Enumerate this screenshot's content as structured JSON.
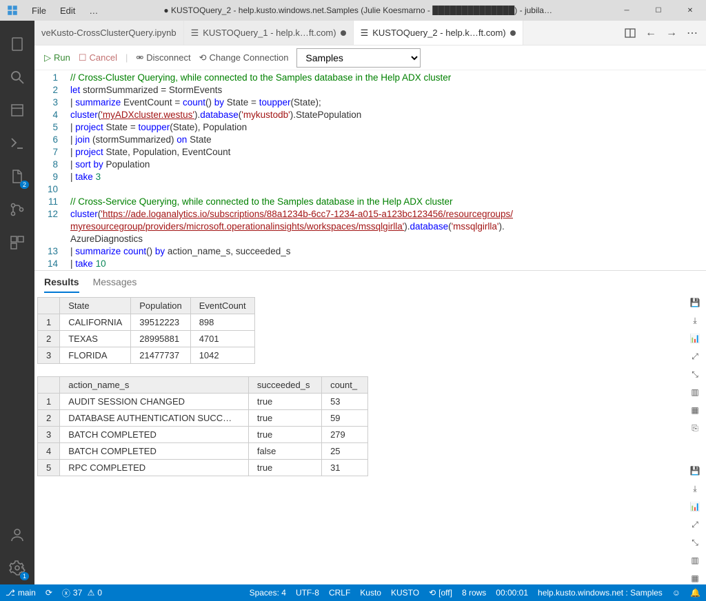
{
  "titlebar": {
    "menu": [
      "File",
      "Edit",
      "…"
    ],
    "title": "● KUSTOQuery_2 - help.kusto.windows.net.Samples (Julie Koesmarno - ██████████████) - jubila…"
  },
  "activity": {
    "explorer_badge": "2",
    "settings_badge": "1"
  },
  "tabs": [
    {
      "label": "veKusto-CrossClusterQuery.ipynb",
      "dirty": false
    },
    {
      "label": "KUSTOQuery_1 - help.k…ft.com)",
      "dirty": true
    },
    {
      "label": "KUSTOQuery_2 - help.k…ft.com)",
      "dirty": true,
      "active": true
    }
  ],
  "toolbar": {
    "run": "Run",
    "cancel": "Cancel",
    "disconnect": "Disconnect",
    "change_conn": "Change Connection",
    "db_selected": "Samples"
  },
  "code": {
    "lines": [
      {
        "n": "1",
        "seg": [
          {
            "c": "tok-comment",
            "t": "// Cross-Cluster Querying, while connected to the Samples database in the Help ADX cluster"
          }
        ]
      },
      {
        "n": "2",
        "seg": [
          {
            "c": "tok-kw",
            "t": "let"
          },
          {
            "c": "",
            "t": " stormSummarized = StormEvents"
          }
        ]
      },
      {
        "n": "3",
        "seg": [
          {
            "c": "",
            "t": "| "
          },
          {
            "c": "tok-kw",
            "t": "summarize"
          },
          {
            "c": "",
            "t": " EventCount = "
          },
          {
            "c": "tok-func",
            "t": "count"
          },
          {
            "c": "",
            "t": "() "
          },
          {
            "c": "tok-kw",
            "t": "by"
          },
          {
            "c": "",
            "t": " State = "
          },
          {
            "c": "tok-func",
            "t": "toupper"
          },
          {
            "c": "",
            "t": "(State);"
          }
        ]
      },
      {
        "n": "4",
        "seg": [
          {
            "c": "tok-func",
            "t": "cluster"
          },
          {
            "c": "",
            "t": "("
          },
          {
            "c": "tok-str",
            "t": "'myADXcluster.westus'"
          },
          {
            "c": "",
            "t": ")."
          },
          {
            "c": "tok-func",
            "t": "database"
          },
          {
            "c": "",
            "t": "("
          },
          {
            "c": "tok-str2",
            "t": "'mykustodb'"
          },
          {
            "c": "",
            "t": ").StatePopulation"
          }
        ]
      },
      {
        "n": "5",
        "seg": [
          {
            "c": "",
            "t": "| "
          },
          {
            "c": "tok-kw",
            "t": "project"
          },
          {
            "c": "",
            "t": " State = "
          },
          {
            "c": "tok-func",
            "t": "toupper"
          },
          {
            "c": "",
            "t": "(State), Population"
          }
        ]
      },
      {
        "n": "6",
        "seg": [
          {
            "c": "",
            "t": "| "
          },
          {
            "c": "tok-kw",
            "t": "join"
          },
          {
            "c": "",
            "t": " (stormSummarized) "
          },
          {
            "c": "tok-kw",
            "t": "on"
          },
          {
            "c": "",
            "t": " State"
          }
        ]
      },
      {
        "n": "7",
        "seg": [
          {
            "c": "",
            "t": "| "
          },
          {
            "c": "tok-kw",
            "t": "project"
          },
          {
            "c": "",
            "t": " State, Population, EventCount"
          }
        ]
      },
      {
        "n": "8",
        "seg": [
          {
            "c": "",
            "t": "| "
          },
          {
            "c": "tok-kw",
            "t": "sort by"
          },
          {
            "c": "",
            "t": " Population"
          }
        ]
      },
      {
        "n": "9",
        "seg": [
          {
            "c": "",
            "t": "| "
          },
          {
            "c": "tok-kw",
            "t": "take"
          },
          {
            "c": "",
            "t": " "
          },
          {
            "c": "tok-num",
            "t": "3"
          }
        ]
      },
      {
        "n": "10",
        "seg": [
          {
            "c": "",
            "t": ""
          }
        ]
      },
      {
        "n": "11",
        "seg": [
          {
            "c": "tok-comment",
            "t": "// Cross-Service Querying, while connected to the Samples database in the Help ADX cluster"
          }
        ]
      },
      {
        "n": "12",
        "seg": [
          {
            "c": "tok-func",
            "t": "cluster"
          },
          {
            "c": "",
            "t": "("
          },
          {
            "c": "tok-str",
            "t": "'https://ade.loganalytics.io/subscriptions/88a1234b-6cc7-1234-a015-a123bc123456/resourcegroups/"
          }
        ]
      },
      {
        "n": "",
        "seg": [
          {
            "c": "tok-str",
            "t": "myresourcegroup/providers/microsoft.operationalinsights/workspaces/mssqlgirlla'"
          },
          {
            "c": "",
            "t": ")."
          },
          {
            "c": "tok-func",
            "t": "database"
          },
          {
            "c": "",
            "t": "("
          },
          {
            "c": "tok-str2",
            "t": "'mssqlgirlla'"
          },
          {
            "c": "",
            "t": ")."
          }
        ]
      },
      {
        "n": "",
        "seg": [
          {
            "c": "",
            "t": "AzureDiagnostics"
          }
        ]
      },
      {
        "n": "13",
        "seg": [
          {
            "c": "",
            "t": "| "
          },
          {
            "c": "tok-kw",
            "t": "summarize"
          },
          {
            "c": "",
            "t": " "
          },
          {
            "c": "tok-func",
            "t": "count"
          },
          {
            "c": "",
            "t": "() "
          },
          {
            "c": "tok-kw",
            "t": "by"
          },
          {
            "c": "",
            "t": " action_name_s, succeeded_s"
          }
        ]
      },
      {
        "n": "14",
        "seg": [
          {
            "c": "",
            "t": "| "
          },
          {
            "c": "tok-kw",
            "t": "take"
          },
          {
            "c": "",
            "t": " "
          },
          {
            "c": "tok-num",
            "t": "10"
          }
        ]
      }
    ]
  },
  "results": {
    "tabs": {
      "results": "Results",
      "messages": "Messages"
    },
    "table1": {
      "headers": [
        "State",
        "Population",
        "EventCount"
      ],
      "rows": [
        [
          "CALIFORNIA",
          "39512223",
          "898"
        ],
        [
          "TEXAS",
          "28995881",
          "4701"
        ],
        [
          "FLORIDA",
          "21477737",
          "1042"
        ]
      ]
    },
    "table2": {
      "headers": [
        "action_name_s",
        "succeeded_s",
        "count_"
      ],
      "rows": [
        [
          "AUDIT SESSION CHANGED",
          "true",
          "53"
        ],
        [
          "DATABASE AUTHENTICATION SUCC…",
          "true",
          "59"
        ],
        [
          "BATCH COMPLETED",
          "true",
          "279"
        ],
        [
          "BATCH COMPLETED",
          "false",
          "25"
        ],
        [
          "RPC COMPLETED",
          "true",
          "31"
        ]
      ]
    }
  },
  "status": {
    "branch": "main",
    "errors": "37",
    "warnings": "0",
    "spaces": "Spaces: 4",
    "encoding": "UTF-8",
    "eol": "CRLF",
    "lang": "Kusto",
    "lang2": "KUSTO",
    "off": "[off]",
    "rows": "8 rows",
    "time": "00:00:01",
    "conn": "help.kusto.windows.net : Samples"
  }
}
